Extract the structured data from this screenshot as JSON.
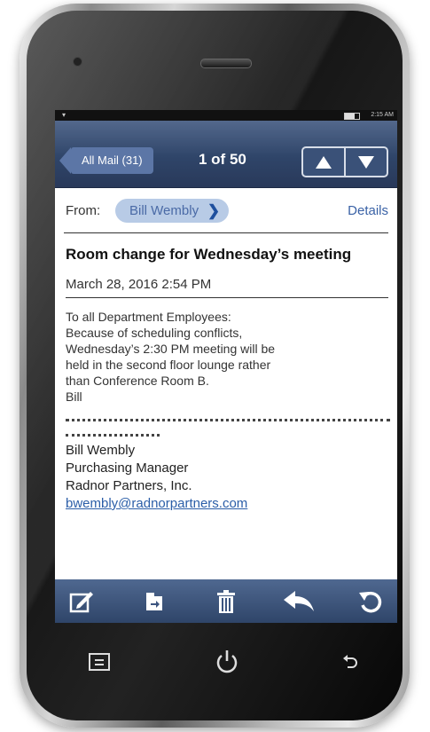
{
  "status_bar": {
    "time": "2:15 AM"
  },
  "header": {
    "back_label": "All Mail (31)",
    "counter": "1 of 50"
  },
  "email": {
    "from_label": "From:",
    "sender": "Bill Wembly",
    "details_label": "Details",
    "subject": "Room change for Wednesday’s meeting",
    "date": "March 28, 2016 2:54 PM",
    "body_lines": [
      "To all Department Employees:",
      "Because of scheduling conflicts,",
      "Wednesday’s 2:30 PM meeting will be",
      "held in the second floor lounge rather",
      "than Conference Room B.",
      "Bill"
    ],
    "signature": {
      "name": "Bill Wembly",
      "title": "Purchasing Manager",
      "company": "Radnor Partners, Inc.",
      "email": "bwembly@radnorpartners.com"
    }
  },
  "toolbar": [
    "compose-icon",
    "move-to-folder-icon",
    "trash-icon",
    "reply-icon",
    "refresh-icon"
  ],
  "hardware_keys": [
    "menu-icon",
    "power-icon",
    "back-icon"
  ],
  "colors": {
    "header": "#2f4569",
    "link": "#3a62a6",
    "chip": "#b8cbe6"
  }
}
